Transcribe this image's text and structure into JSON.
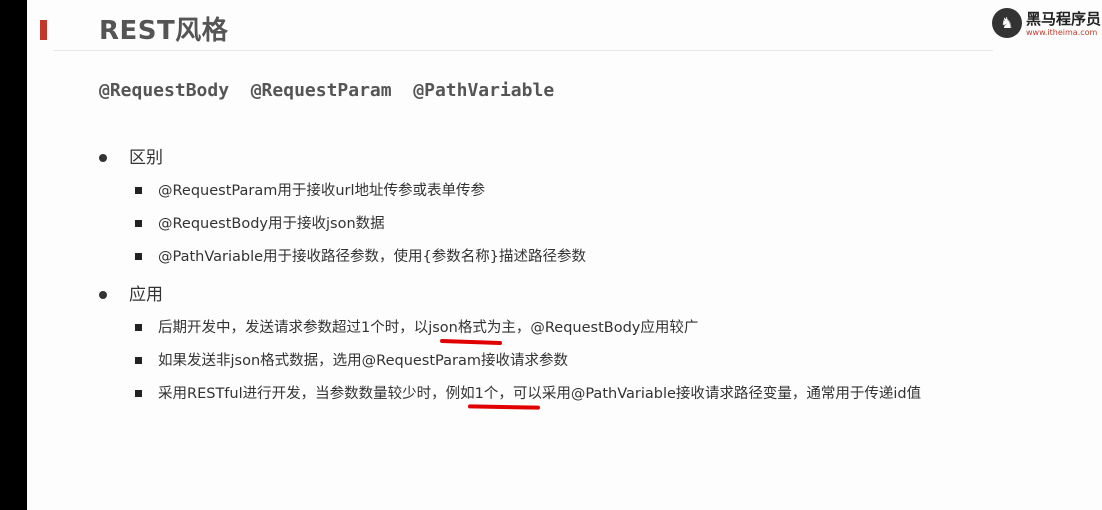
{
  "slide": {
    "title": "REST风格",
    "logo_name": "黑马程序员",
    "logo_url": "www.itheima.com",
    "annotations": "@RequestBody  @RequestParam  @PathVariable"
  },
  "sections": [
    {
      "label": "区别",
      "items": [
        "@RequestParam用于接收url地址传参或表单传参",
        "@RequestBody用于接收json数据",
        "@PathVariable用于接收路径参数，使用{参数名称}描述路径参数"
      ]
    },
    {
      "label": "应用",
      "items": [
        "后期开发中，发送请求参数超过1个时，以json格式为主，@RequestBody应用较广",
        "如果发送非json格式数据，选用@RequestParam接收请求参数",
        "采用RESTful进行开发，当参数数量较少时，例如1个，可以采用@PathVariable接收请求路径变量，通常用于传递id值"
      ]
    }
  ],
  "colors": {
    "accent": "#c0392b",
    "annotation_mark": "#e00000"
  }
}
